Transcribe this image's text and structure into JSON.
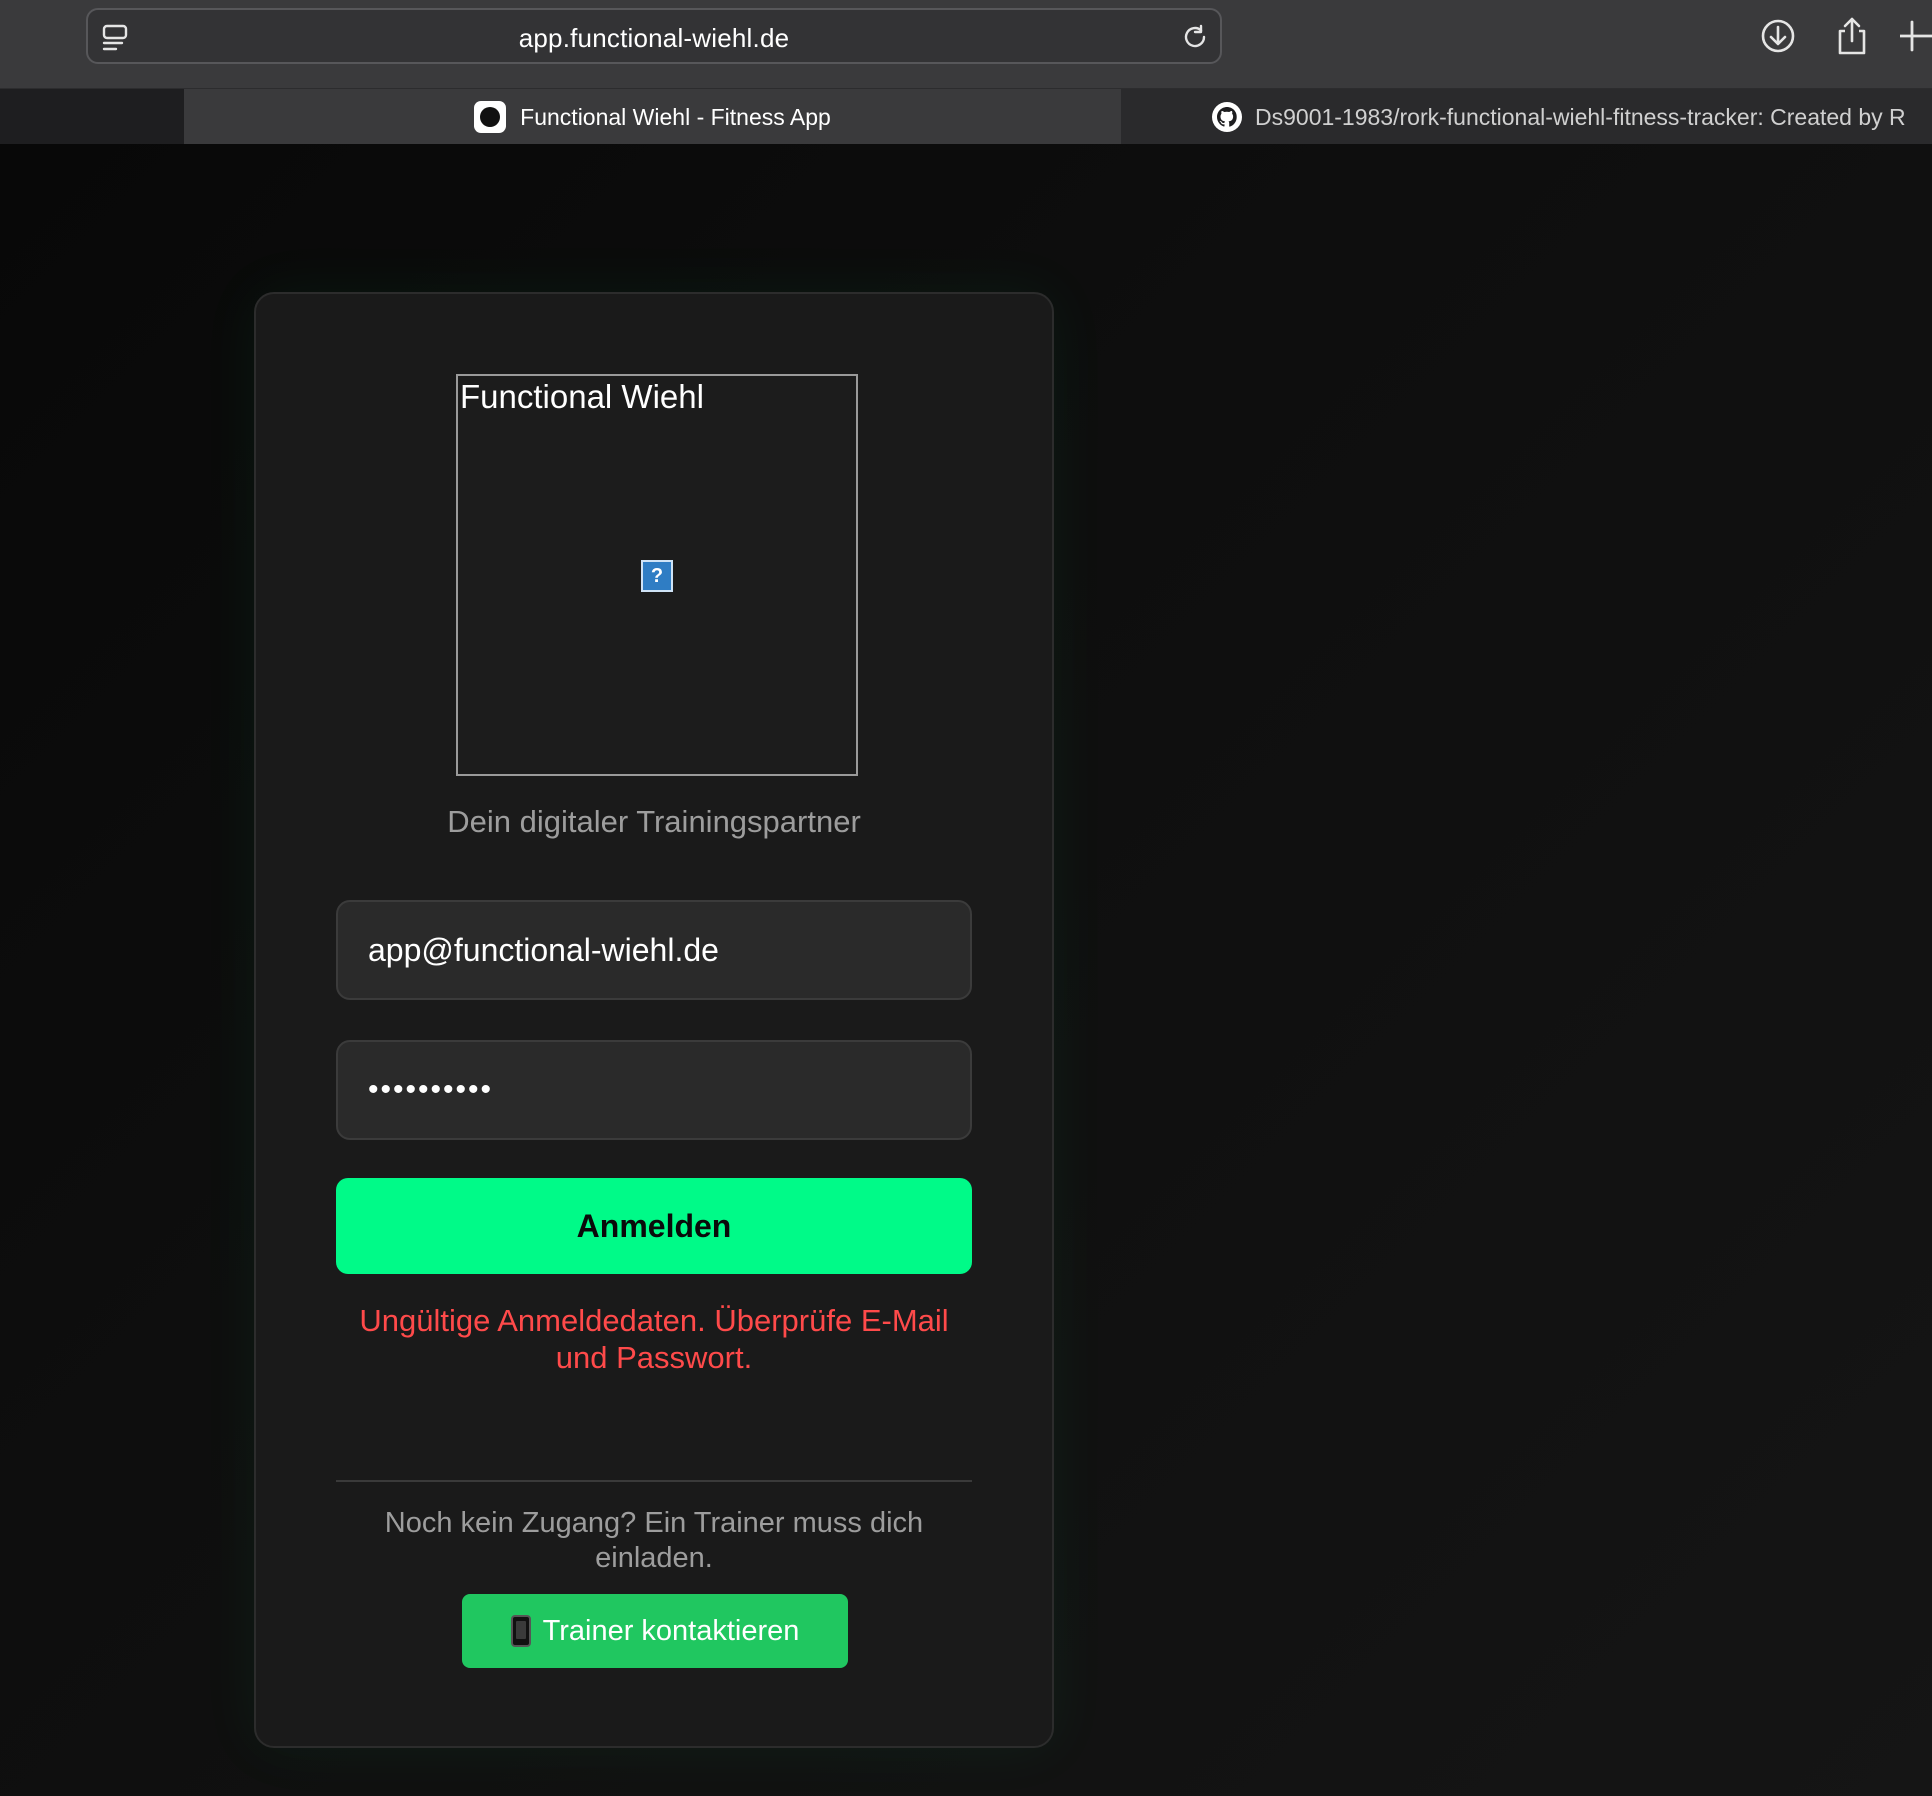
{
  "browser": {
    "url": "app.functional-wiehl.de",
    "tabs": [
      {
        "title": "Functional Wiehl - Fitness App",
        "active": true
      },
      {
        "title": "Ds9001-1983/rork-functional-wiehl-fitness-tracker: Created by R",
        "active": false
      }
    ],
    "toolbar_icons": [
      "sidebar-icon",
      "reload-icon",
      "download-icon",
      "share-icon",
      "new-tab-icon"
    ]
  },
  "login": {
    "logo_alt": "Functional Wiehl",
    "tagline": "Dein digitaler Trainingspartner",
    "email_value": "app@functional-wiehl.de",
    "password_value": "••••••••••",
    "submit_label": "Anmelden",
    "error": "Ungültige Anmeldedaten. Überprüfe E-Mail und Passwort.",
    "invite_text": "Noch kein Zugang? Ein Trainer muss dich einladen.",
    "contact_label": "Trainer kontaktieren"
  },
  "colors": {
    "accent": "#00fa88",
    "contact_button": "#20c760",
    "error": "#ff4a4a",
    "card_bg": "#1a1a1a"
  }
}
